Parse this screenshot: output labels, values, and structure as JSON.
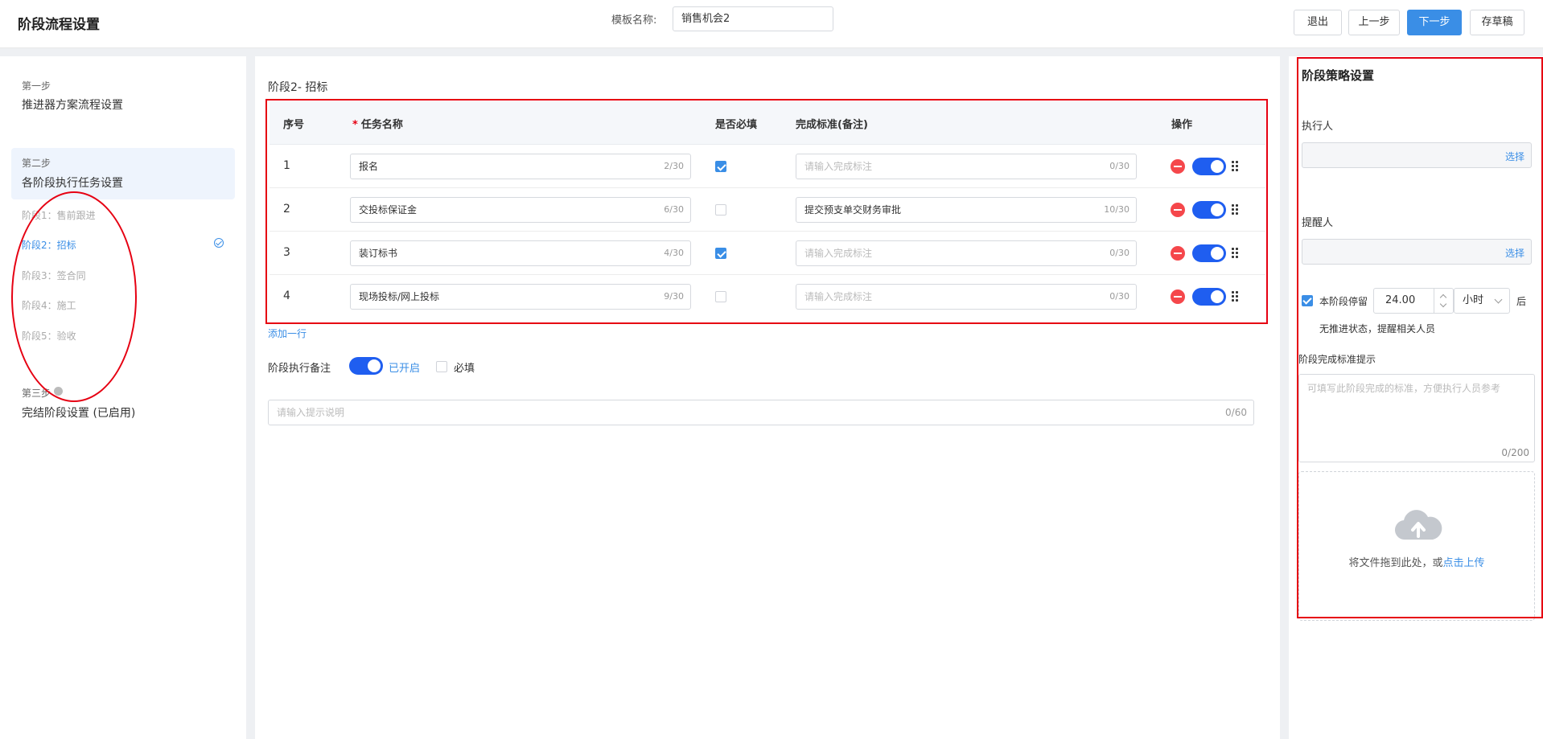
{
  "header": {
    "title": "阶段流程设置",
    "template_label": "模板名称:",
    "template_value": "销售机会2",
    "buttons": {
      "exit": "退出",
      "prev": "上一步",
      "next": "下一步",
      "draft": "存草稿"
    }
  },
  "sidebar": {
    "step1": {
      "tag": "第一步",
      "title": "推进器方案流程设置"
    },
    "step2": {
      "tag": "第二步",
      "title": "各阶段执行任务设置"
    },
    "stages": [
      {
        "label": "阶段1：售前跟进",
        "active": false
      },
      {
        "label": "阶段2：招标",
        "active": true
      },
      {
        "label": "阶段3：签合同",
        "active": false
      },
      {
        "label": "阶段4：施工",
        "active": false
      },
      {
        "label": "阶段5：验收",
        "active": false
      }
    ],
    "step3": {
      "tag": "第三步",
      "title": "完结阶段设置 (已启用)"
    }
  },
  "main": {
    "stage_heading": "阶段2- 招标",
    "table": {
      "headers": {
        "no": "序号",
        "name": "任务名称",
        "required_mark": "*",
        "required": "是否必填",
        "standard": "完成标准(备注)",
        "actions": "操作"
      },
      "rows": [
        {
          "no": "1",
          "name": "报名",
          "name_count": "2/30",
          "required": true,
          "standard": "请输入完成标注",
          "standard_placeholder": true,
          "standard_count": "0/30"
        },
        {
          "no": "2",
          "name": "交投标保证金",
          "name_count": "6/30",
          "required": false,
          "standard": "提交预支单交财务审批",
          "standard_placeholder": false,
          "standard_count": "10/30"
        },
        {
          "no": "3",
          "name": "装订标书",
          "name_count": "4/30",
          "required": true,
          "standard": "请输入完成标注",
          "standard_placeholder": true,
          "standard_count": "0/30"
        },
        {
          "no": "4",
          "name": "现场投标/网上投标",
          "name_count": "9/30",
          "required": false,
          "standard": "请输入完成标注",
          "standard_placeholder": true,
          "standard_count": "0/30"
        }
      ]
    },
    "add_row": "添加一行",
    "remark": {
      "label": "阶段执行备注",
      "status": "已开启",
      "required": "必填"
    },
    "tip": {
      "placeholder": "请输入提示说明",
      "count": "0/60"
    }
  },
  "right_panel": {
    "title": "阶段策略设置",
    "executor": {
      "label": "执行人",
      "action": "选择"
    },
    "reminder": {
      "label": "提醒人",
      "action": "选择"
    },
    "stay": {
      "label": "本阶段停留",
      "value": "24.00",
      "unit": "小时",
      "after": "后",
      "note": "无推进状态，提醒相关人员"
    },
    "standard_tip": {
      "label": "阶段完成标准提示",
      "placeholder": "可填写此阶段完成的标准，方便执行人员参考",
      "count": "0/200"
    },
    "upload": {
      "text": "将文件拖到此处，或",
      "link": "点击上传"
    }
  },
  "colors": {
    "accent": "#3a8ee6",
    "toggle": "#1f5ef0",
    "danger": "#f5474b",
    "annotation": "#e60012"
  }
}
